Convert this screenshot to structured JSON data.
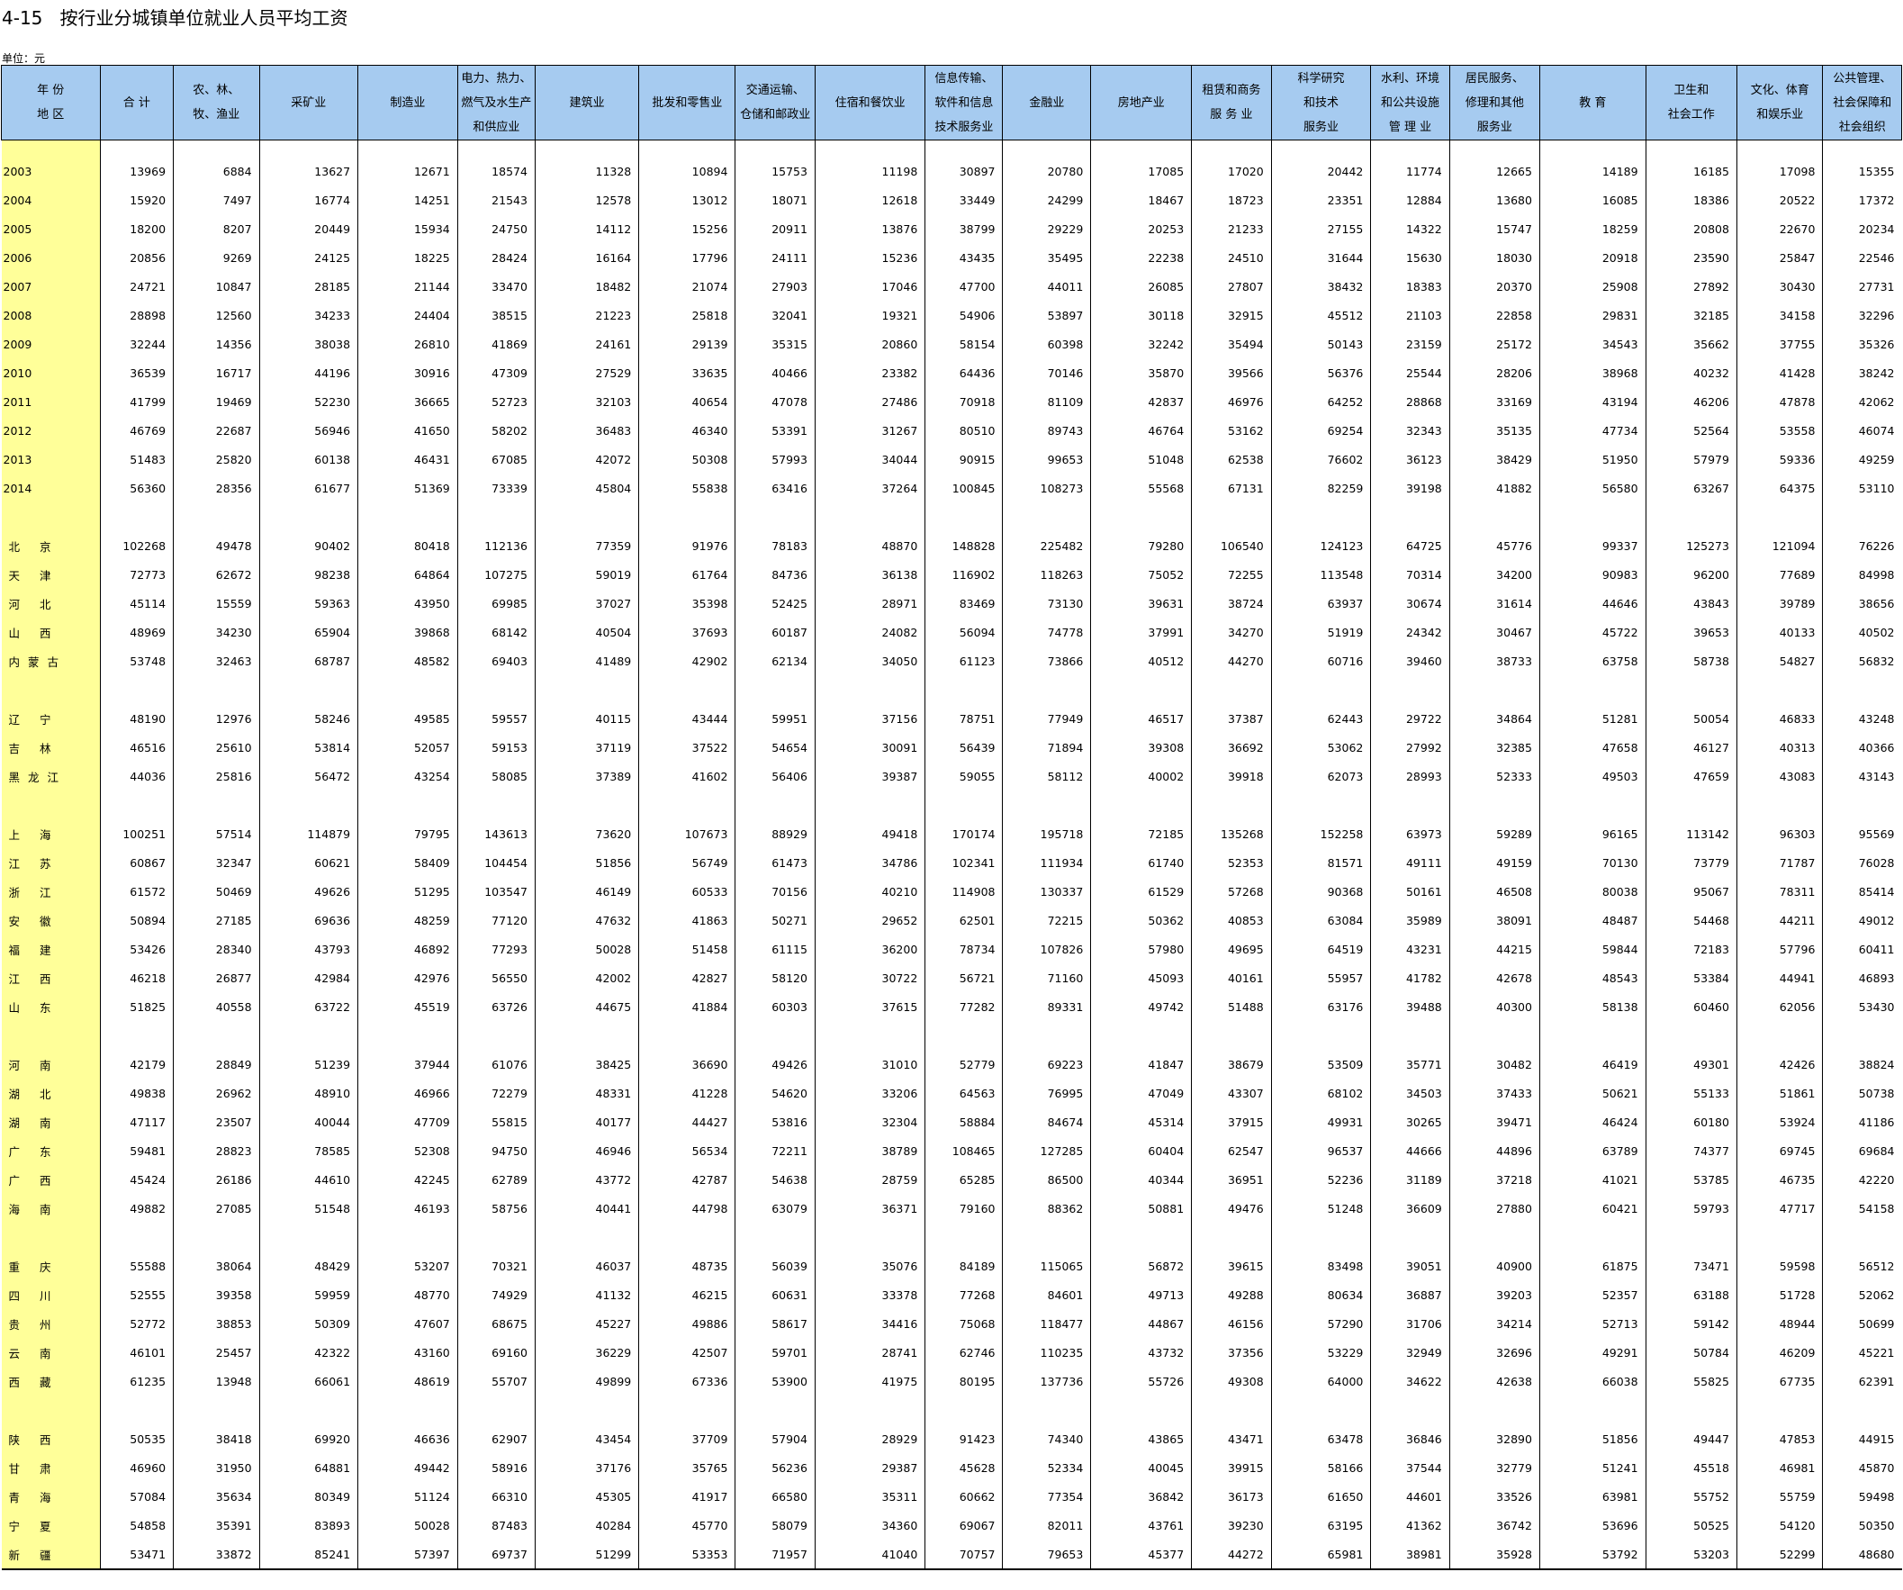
{
  "title": "4-15   按行业分城镇单位就业人员平均工资",
  "unit": "单位：元",
  "colors": {
    "header_bg": "#a6cbf0",
    "label_bg": "#ffff99"
  },
  "columns": [
    [
      "年 份",
      "地 区"
    ],
    [
      "合 计"
    ],
    [
      "农、林、",
      "牧、渔业"
    ],
    [
      "采矿业"
    ],
    [
      "制造业"
    ],
    [
      "电力、热力、",
      "燃气及水生产",
      "和供应业"
    ],
    [
      "建筑业"
    ],
    [
      "批发和零售业"
    ],
    [
      "交通运输、",
      "仓储和邮政业"
    ],
    [
      "住宿和餐饮业"
    ],
    [
      "信息传输、",
      "软件和信息",
      "技术服务业"
    ],
    [
      "金融业"
    ],
    [
      "房地产业"
    ],
    [
      "租赁和商务",
      "服 务 业"
    ],
    [
      "科学研究",
      "和技术",
      "服务业"
    ],
    [
      "水利、环境",
      "和公共设施",
      "管 理 业"
    ],
    [
      "居民服务、",
      "修理和其他",
      "服务业"
    ],
    [
      "教  育"
    ],
    [
      "卫生和",
      "社会工作"
    ],
    [
      "文化、体育",
      "和娱乐业"
    ],
    [
      "公共管理、",
      "社会保障和",
      "社会组织"
    ]
  ],
  "groups": [
    [
      [
        "2003",
        "13969",
        "6884",
        "13627",
        "12671",
        "18574",
        "11328",
        "10894",
        "15753",
        "11198",
        "30897",
        "20780",
        "17085",
        "17020",
        "20442",
        "11774",
        "12665",
        "14189",
        "16185",
        "17098",
        "15355"
      ],
      [
        "2004",
        "15920",
        "7497",
        "16774",
        "14251",
        "21543",
        "12578",
        "13012",
        "18071",
        "12618",
        "33449",
        "24299",
        "18467",
        "18723",
        "23351",
        "12884",
        "13680",
        "16085",
        "18386",
        "20522",
        "17372"
      ],
      [
        "2005",
        "18200",
        "8207",
        "20449",
        "15934",
        "24750",
        "14112",
        "15256",
        "20911",
        "13876",
        "38799",
        "29229",
        "20253",
        "21233",
        "27155",
        "14322",
        "15747",
        "18259",
        "20808",
        "22670",
        "20234"
      ],
      [
        "2006",
        "20856",
        "9269",
        "24125",
        "18225",
        "28424",
        "16164",
        "17796",
        "24111",
        "15236",
        "43435",
        "35495",
        "22238",
        "24510",
        "31644",
        "15630",
        "18030",
        "20918",
        "23590",
        "25847",
        "22546"
      ],
      [
        "2007",
        "24721",
        "10847",
        "28185",
        "21144",
        "33470",
        "18482",
        "21074",
        "27903",
        "17046",
        "47700",
        "44011",
        "26085",
        "27807",
        "38432",
        "18383",
        "20370",
        "25908",
        "27892",
        "30430",
        "27731"
      ],
      [
        "2008",
        "28898",
        "12560",
        "34233",
        "24404",
        "38515",
        "21223",
        "25818",
        "32041",
        "19321",
        "54906",
        "53897",
        "30118",
        "32915",
        "45512",
        "21103",
        "22858",
        "29831",
        "32185",
        "34158",
        "32296"
      ],
      [
        "2009",
        "32244",
        "14356",
        "38038",
        "26810",
        "41869",
        "24161",
        "29139",
        "35315",
        "20860",
        "58154",
        "60398",
        "32242",
        "35494",
        "50143",
        "23159",
        "25172",
        "34543",
        "35662",
        "37755",
        "35326"
      ],
      [
        "2010",
        "36539",
        "16717",
        "44196",
        "30916",
        "47309",
        "27529",
        "33635",
        "40466",
        "23382",
        "64436",
        "70146",
        "35870",
        "39566",
        "56376",
        "25544",
        "28206",
        "38968",
        "40232",
        "41428",
        "38242"
      ],
      [
        "2011",
        "41799",
        "19469",
        "52230",
        "36665",
        "52723",
        "32103",
        "40654",
        "47078",
        "27486",
        "70918",
        "81109",
        "42837",
        "46976",
        "64252",
        "28868",
        "33169",
        "43194",
        "46206",
        "47878",
        "42062"
      ],
      [
        "2012",
        "46769",
        "22687",
        "56946",
        "41650",
        "58202",
        "36483",
        "46340",
        "53391",
        "31267",
        "80510",
        "89743",
        "46764",
        "53162",
        "69254",
        "32343",
        "35135",
        "47734",
        "52564",
        "53558",
        "46074"
      ],
      [
        "2013",
        "51483",
        "25820",
        "60138",
        "46431",
        "67085",
        "42072",
        "50308",
        "57993",
        "34044",
        "90915",
        "99653",
        "51048",
        "62538",
        "76602",
        "36123",
        "38429",
        "51950",
        "57979",
        "59336",
        "49259"
      ],
      [
        "2014",
        "56360",
        "28356",
        "61677",
        "51369",
        "73339",
        "45804",
        "55838",
        "63416",
        "37264",
        "100845",
        "108273",
        "55568",
        "67131",
        "82259",
        "39198",
        "41882",
        "56580",
        "63267",
        "64375",
        "53110"
      ]
    ],
    [
      [
        "北  京",
        "102268",
        "49478",
        "90402",
        "80418",
        "112136",
        "77359",
        "91976",
        "78183",
        "48870",
        "148828",
        "225482",
        "79280",
        "106540",
        "124123",
        "64725",
        "45776",
        "99337",
        "125273",
        "121094",
        "76226"
      ],
      [
        "天  津",
        "72773",
        "62672",
        "98238",
        "64864",
        "107275",
        "59019",
        "61764",
        "84736",
        "36138",
        "116902",
        "118263",
        "75052",
        "72255",
        "113548",
        "70314",
        "34200",
        "90983",
        "96200",
        "77689",
        "84998"
      ],
      [
        "河  北",
        "45114",
        "15559",
        "59363",
        "43950",
        "69985",
        "37027",
        "35398",
        "52425",
        "28971",
        "83469",
        "73130",
        "39631",
        "38724",
        "63937",
        "30674",
        "31614",
        "44646",
        "43843",
        "39789",
        "38656"
      ],
      [
        "山  西",
        "48969",
        "34230",
        "65904",
        "39868",
        "68142",
        "40504",
        "37693",
        "60187",
        "24082",
        "56094",
        "74778",
        "37991",
        "34270",
        "51919",
        "24342",
        "30467",
        "45722",
        "39653",
        "40133",
        "40502"
      ],
      [
        "内蒙古",
        "53748",
        "32463",
        "68787",
        "48582",
        "69403",
        "41489",
        "42902",
        "62134",
        "34050",
        "61123",
        "73866",
        "40512",
        "44270",
        "60716",
        "39460",
        "38733",
        "63758",
        "58738",
        "54827",
        "56832"
      ]
    ],
    [
      [
        "辽  宁",
        "48190",
        "12976",
        "58246",
        "49585",
        "59557",
        "40115",
        "43444",
        "59951",
        "37156",
        "78751",
        "77949",
        "46517",
        "37387",
        "62443",
        "29722",
        "34864",
        "51281",
        "50054",
        "46833",
        "43248"
      ],
      [
        "吉  林",
        "46516",
        "25610",
        "53814",
        "52057",
        "59153",
        "37119",
        "37522",
        "54654",
        "30091",
        "56439",
        "71894",
        "39308",
        "36692",
        "53062",
        "27992",
        "32385",
        "47658",
        "46127",
        "40313",
        "40366"
      ],
      [
        "黑龙江",
        "44036",
        "25816",
        "56472",
        "43254",
        "58085",
        "37389",
        "41602",
        "56406",
        "39387",
        "59055",
        "58112",
        "40002",
        "39918",
        "62073",
        "28993",
        "52333",
        "49503",
        "47659",
        "43083",
        "43143"
      ]
    ],
    [
      [
        "上  海",
        "100251",
        "57514",
        "114879",
        "79795",
        "143613",
        "73620",
        "107673",
        "88929",
        "49418",
        "170174",
        "195718",
        "72185",
        "135268",
        "152258",
        "63973",
        "59289",
        "96165",
        "113142",
        "96303",
        "95569"
      ],
      [
        "江  苏",
        "60867",
        "32347",
        "60621",
        "58409",
        "104454",
        "51856",
        "56749",
        "61473",
        "34786",
        "102341",
        "111934",
        "61740",
        "52353",
        "81571",
        "49111",
        "49159",
        "70130",
        "73779",
        "71787",
        "76028"
      ],
      [
        "浙  江",
        "61572",
        "50469",
        "49626",
        "51295",
        "103547",
        "46149",
        "60533",
        "70156",
        "40210",
        "114908",
        "130337",
        "61529",
        "57268",
        "90368",
        "50161",
        "46508",
        "80038",
        "95067",
        "78311",
        "85414"
      ],
      [
        "安  徽",
        "50894",
        "27185",
        "69636",
        "48259",
        "77120",
        "47632",
        "41863",
        "50271",
        "29652",
        "62501",
        "72215",
        "50362",
        "40853",
        "63084",
        "35989",
        "38091",
        "48487",
        "54468",
        "44211",
        "49012"
      ],
      [
        "福  建",
        "53426",
        "28340",
        "43793",
        "46892",
        "77293",
        "50028",
        "51458",
        "61115",
        "36200",
        "78734",
        "107826",
        "57980",
        "49695",
        "64519",
        "43231",
        "44215",
        "59844",
        "72183",
        "57796",
        "60411"
      ],
      [
        "江  西",
        "46218",
        "26877",
        "42984",
        "42976",
        "56550",
        "42002",
        "42827",
        "58120",
        "30722",
        "56721",
        "71160",
        "45093",
        "40161",
        "55957",
        "41782",
        "42678",
        "48543",
        "53384",
        "44941",
        "46893"
      ],
      [
        "山  东",
        "51825",
        "40558",
        "63722",
        "45519",
        "63726",
        "44675",
        "41884",
        "60303",
        "37615",
        "77282",
        "89331",
        "49742",
        "51488",
        "63176",
        "39488",
        "40300",
        "58138",
        "60460",
        "62056",
        "53430"
      ]
    ],
    [
      [
        "河  南",
        "42179",
        "28849",
        "51239",
        "37944",
        "61076",
        "38425",
        "36690",
        "49426",
        "31010",
        "52779",
        "69223",
        "41847",
        "38679",
        "53509",
        "35771",
        "30482",
        "46419",
        "49301",
        "42426",
        "38824"
      ],
      [
        "湖  北",
        "49838",
        "26962",
        "48910",
        "46966",
        "72279",
        "48331",
        "41228",
        "54620",
        "33206",
        "64563",
        "76995",
        "47049",
        "43307",
        "68102",
        "34503",
        "37433",
        "50621",
        "55133",
        "51861",
        "50738"
      ],
      [
        "湖  南",
        "47117",
        "23507",
        "40044",
        "47709",
        "55815",
        "40177",
        "44427",
        "53816",
        "32304",
        "58884",
        "84674",
        "45314",
        "37915",
        "49931",
        "30265",
        "39471",
        "46424",
        "60180",
        "53924",
        "41186"
      ],
      [
        "广  东",
        "59481",
        "28823",
        "78585",
        "52308",
        "94750",
        "46946",
        "56534",
        "72211",
        "38789",
        "108465",
        "127285",
        "60404",
        "62547",
        "96537",
        "44666",
        "44896",
        "63789",
        "74377",
        "69745",
        "69684"
      ],
      [
        "广  西",
        "45424",
        "26186",
        "44610",
        "42245",
        "62789",
        "43772",
        "42787",
        "54638",
        "28759",
        "65285",
        "86500",
        "40344",
        "36951",
        "52236",
        "31189",
        "37218",
        "41021",
        "53785",
        "46735",
        "42220"
      ],
      [
        "海  南",
        "49882",
        "27085",
        "51548",
        "46193",
        "58756",
        "40441",
        "44798",
        "63079",
        "36371",
        "79160",
        "88362",
        "50881",
        "49476",
        "51248",
        "36609",
        "27880",
        "60421",
        "59793",
        "47717",
        "54158"
      ]
    ],
    [
      [
        "重  庆",
        "55588",
        "38064",
        "48429",
        "53207",
        "70321",
        "46037",
        "48735",
        "56039",
        "35076",
        "84189",
        "115065",
        "56872",
        "39615",
        "83498",
        "39051",
        "40900",
        "61875",
        "73471",
        "59598",
        "56512"
      ],
      [
        "四  川",
        "52555",
        "39358",
        "59959",
        "48770",
        "74929",
        "41132",
        "46215",
        "60631",
        "33378",
        "77268",
        "84601",
        "49713",
        "49288",
        "80634",
        "36887",
        "39203",
        "52357",
        "63188",
        "51728",
        "52062"
      ],
      [
        "贵  州",
        "52772",
        "38853",
        "50309",
        "47607",
        "68675",
        "45227",
        "49886",
        "58617",
        "34416",
        "75068",
        "118477",
        "44867",
        "46156",
        "57290",
        "31706",
        "34214",
        "52713",
        "59142",
        "48944",
        "50699"
      ],
      [
        "云  南",
        "46101",
        "25457",
        "42322",
        "43160",
        "69160",
        "36229",
        "42507",
        "59701",
        "28741",
        "62746",
        "110235",
        "43732",
        "37356",
        "53229",
        "32949",
        "32696",
        "49291",
        "50784",
        "46209",
        "45221"
      ],
      [
        "西  藏",
        "61235",
        "13948",
        "66061",
        "48619",
        "55707",
        "49899",
        "67336",
        "53900",
        "41975",
        "80195",
        "137736",
        "55726",
        "49308",
        "64000",
        "34622",
        "42638",
        "66038",
        "55825",
        "67735",
        "62391"
      ]
    ],
    [
      [
        "陕  西",
        "50535",
        "38418",
        "69920",
        "46636",
        "62907",
        "43454",
        "37709",
        "57904",
        "28929",
        "91423",
        "74340",
        "43865",
        "43471",
        "63478",
        "36846",
        "32890",
        "51856",
        "49447",
        "47853",
        "44915"
      ],
      [
        "甘  肃",
        "46960",
        "31950",
        "64881",
        "49442",
        "58916",
        "37176",
        "35765",
        "56236",
        "29387",
        "45628",
        "52334",
        "40045",
        "39915",
        "58166",
        "37544",
        "32779",
        "51241",
        "45518",
        "46981",
        "45870"
      ],
      [
        "青  海",
        "57084",
        "35634",
        "80349",
        "51124",
        "66310",
        "45305",
        "41917",
        "66580",
        "35311",
        "60662",
        "77354",
        "36842",
        "36173",
        "61650",
        "44601",
        "33526",
        "63981",
        "55752",
        "55759",
        "59498"
      ],
      [
        "宁  夏",
        "54858",
        "35391",
        "83893",
        "50028",
        "87483",
        "40284",
        "45770",
        "58079",
        "34360",
        "69067",
        "82011",
        "43761",
        "39230",
        "63195",
        "41362",
        "36742",
        "53696",
        "50525",
        "54120",
        "50350"
      ],
      [
        "新  疆",
        "53471",
        "33872",
        "85241",
        "57397",
        "69737",
        "51299",
        "53353",
        "71957",
        "41040",
        "70757",
        "79653",
        "45377",
        "44272",
        "65981",
        "38981",
        "35928",
        "53792",
        "53203",
        "52299",
        "48680"
      ]
    ]
  ]
}
